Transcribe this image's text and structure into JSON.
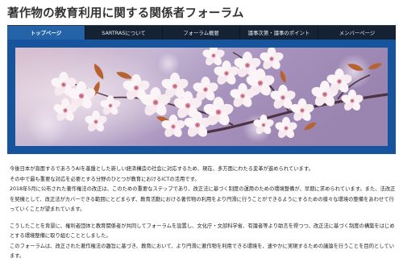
{
  "site": {
    "title": "著作物の教育利用に関する関係者フォーラム"
  },
  "nav": {
    "items": [
      {
        "label": "トップページ",
        "active": true
      },
      {
        "label": "SARTRASについて",
        "active": false
      },
      {
        "label": "フォーラム概要",
        "active": false
      },
      {
        "label": "議事次第・議事のポイント",
        "active": false
      },
      {
        "label": "メンバーページ",
        "active": false
      }
    ]
  },
  "content": {
    "paragraphs": [
      "今後日本が直面するであろうAIを基盤とした新しい経済構造の社会に対応するため、現在、多方面にわたる変革が進められています。\nその中で最も重要な対応を必要とする分野のひとつが教育におけるICTの活用です。\n2018年5月に公布された著作権法の改正は、このための重要なステップであり、改正法に基づく制度の運用のための環境整備が、早期に求められています。また、法改正を契機として、改正法がカバーできる範囲にとどまらず、教育活動における著作物の利用をより円滑に行うことができるようにするための様々な環境の整備をあわせて行っていくことが望まれています。",
      "こうしたことを背景に、権利者団体と教育関係者が共同してフォーラムを設置し、文化庁・文部科学省、有識者等より助言を得つつ、改正法に基づく制度の構築をはじめとする環境整備に取り組むこととしました。\nこのフォーラムは、改正された著作権法の趣旨に基づき、教育において、より円滑に著作物を利用できる環境を、速やかに実現するための議論を行うことを目的としています。"
    ]
  }
}
